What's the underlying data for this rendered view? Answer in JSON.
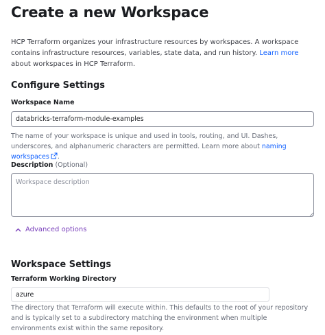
{
  "page": {
    "title": "Create a new Workspace",
    "intro_text": "HCP Terraform organizes your infrastructure resources by workspaces. A workspace contains infrastructure resources, variables, state data, and run history. ",
    "intro_link": "Learn more",
    "intro_suffix": " about workspaces in HCP Terraform."
  },
  "configure": {
    "heading": "Configure Settings",
    "workspace_name": {
      "label": "Workspace Name",
      "value": "databricks-terraform-module-examples",
      "help_text": "The name of your workspace is unique and used in tools, routing, and UI. Dashes, underscores, and alphanumeric characters are permitted. Learn more about ",
      "help_link": "naming workspaces",
      "help_suffix": "."
    },
    "description": {
      "label": "Description",
      "optional": "(Optional)",
      "placeholder": "Workspace description",
      "value": ""
    },
    "advanced_options": "Advanced options"
  },
  "workspace_settings": {
    "heading": "Workspace Settings",
    "working_directory": {
      "label": "Terraform Working Directory",
      "value": "azure",
      "help_text": "The directory that Terraform will execute within. This defaults to the root of your repository and is typically set to a subdirectory matching the environment when multiple environments exist within the same repository."
    }
  },
  "colors": {
    "link": "#1060ff",
    "advanced": "#7b42bc",
    "border": "#8c909c",
    "muted_text": "#656a76"
  },
  "icons": {
    "external_link": "external-link-icon",
    "chevron": "chevron-up-icon",
    "resize": "resize-grip-icon"
  }
}
